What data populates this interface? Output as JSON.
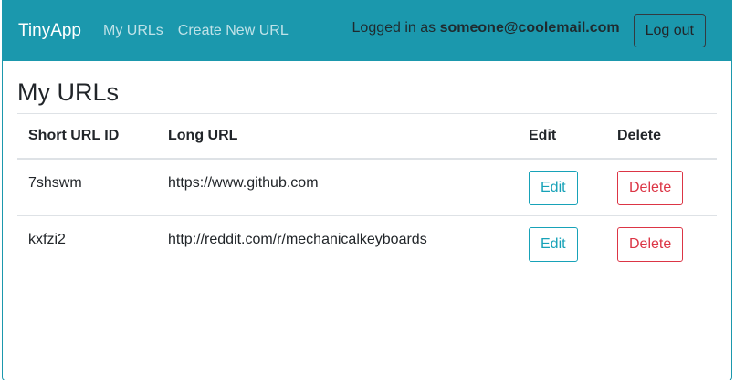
{
  "navbar": {
    "brand": "TinyApp",
    "links": [
      "My URLs",
      "Create New URL"
    ],
    "login_prefix": "Logged in as ",
    "login_email": "someone@coolemail.com",
    "logout_label": "Log out"
  },
  "page": {
    "title": "My URLs"
  },
  "table": {
    "headers": [
      "Short URL ID",
      "Long URL",
      "Edit",
      "Delete"
    ],
    "rows": [
      {
        "short_id": "7shswm",
        "long_url": "https://www.github.com",
        "edit_label": "Edit",
        "delete_label": "Delete"
      },
      {
        "short_id": "kxfzi2",
        "long_url": "http://reddit.com/r/mechanicalkeyboards",
        "edit_label": "Edit",
        "delete_label": "Delete"
      }
    ]
  },
  "colors": {
    "navbar": "#1b98ad",
    "edit": "#17a2b8",
    "delete": "#dc3545"
  }
}
